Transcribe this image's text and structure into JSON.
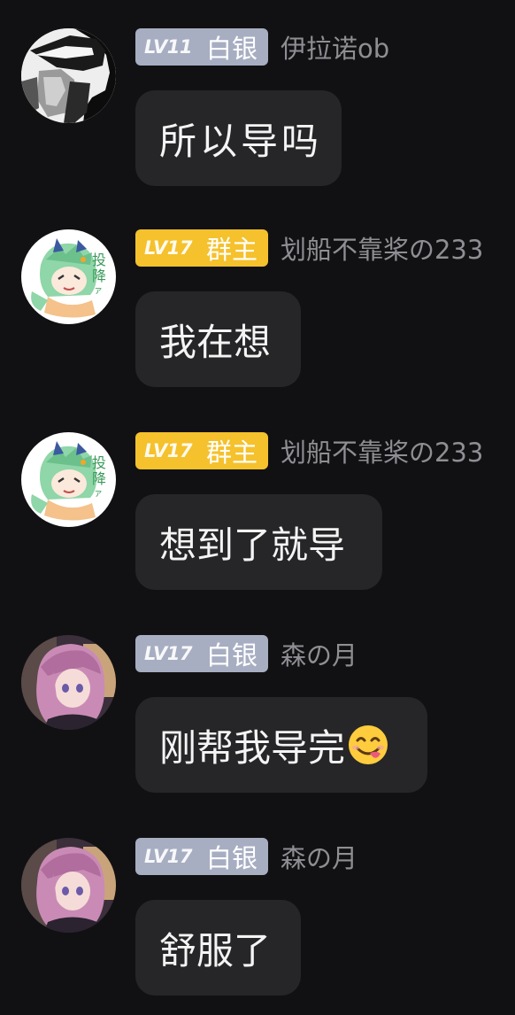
{
  "colors": {
    "background": "#111113",
    "bubble": "#262628",
    "badge_silver": "#a7aec2",
    "badge_owner": "#f5c12c",
    "nickname": "#8e8e93"
  },
  "messages": [
    {
      "level": "LV11",
      "title": "白银",
      "badge_color": "#a7aec2",
      "nickname": "伊拉诺ob",
      "avatar": "dark-grayscale-portrait-avatar",
      "text": "所以导吗"
    },
    {
      "level": "LV17",
      "title": "群主",
      "badge_color": "#f5c12c",
      "nickname": "划船不靠桨の233",
      "avatar": "chibi-green-hair-sticker-avatar",
      "text": "我在想"
    },
    {
      "level": "LV17",
      "title": "群主",
      "badge_color": "#f5c12c",
      "nickname": "划船不靠桨の233",
      "avatar": "chibi-green-hair-sticker-avatar",
      "text": "想到了就导"
    },
    {
      "level": "LV17",
      "title": "白银",
      "badge_color": "#a7aec2",
      "nickname": "森の月",
      "avatar": "pink-hair-anime-girl-avatar",
      "text": "刚帮我导完",
      "emoji": "yum-face-emoji"
    },
    {
      "level": "LV17",
      "title": "白银",
      "badge_color": "#a7aec2",
      "nickname": "森の月",
      "avatar": "pink-hair-anime-girl-avatar",
      "text": "舒服了"
    }
  ]
}
